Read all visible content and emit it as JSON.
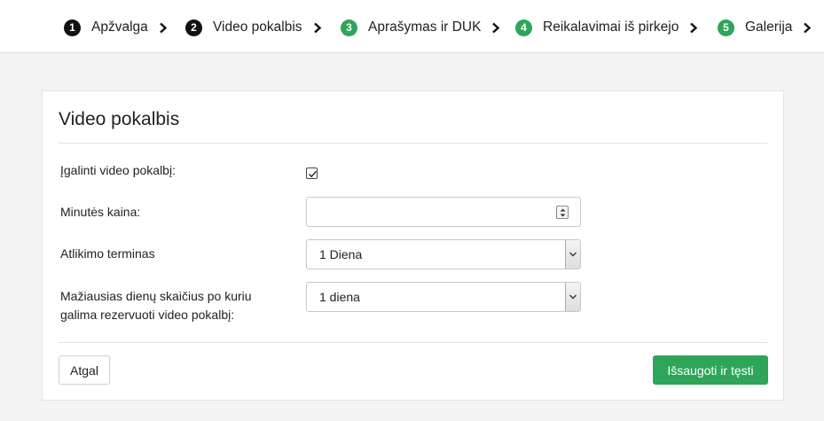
{
  "steps": [
    {
      "number": "1",
      "label": "Apžvalga",
      "status": "done",
      "color": "#111111"
    },
    {
      "number": "2",
      "label": "Video pokalbis",
      "status": "current",
      "color": "#111111"
    },
    {
      "number": "3",
      "label": "Aprašymas ir DUK",
      "status": "pending",
      "color": "#2fa55a"
    },
    {
      "number": "4",
      "label": "Reikalavimai iš pirkejo",
      "status": "pending",
      "color": "#2fa55a"
    },
    {
      "number": "5",
      "label": "Galerija",
      "status": "pending",
      "color": "#2fa55a"
    }
  ],
  "form": {
    "title": "Video pokalbis",
    "enable_label": "Įgalinti video pokalbį:",
    "enable_checked": true,
    "price_label": "Minutės kaina:",
    "price_value": "",
    "term_label": "Atlikimo terminas",
    "term_value": "1 Diena",
    "min_days_label_line1": "Mažiausias dienų skaičius po kuriu",
    "min_days_label_line2": "galima rezervuoti video pokalbį:",
    "min_days_value": "1 diena"
  },
  "actions": {
    "back_label": "Atgal",
    "save_label": "Išsaugoti ir tęsti"
  },
  "colors": {
    "accent": "#2fa55a",
    "dark_step": "#111111"
  }
}
